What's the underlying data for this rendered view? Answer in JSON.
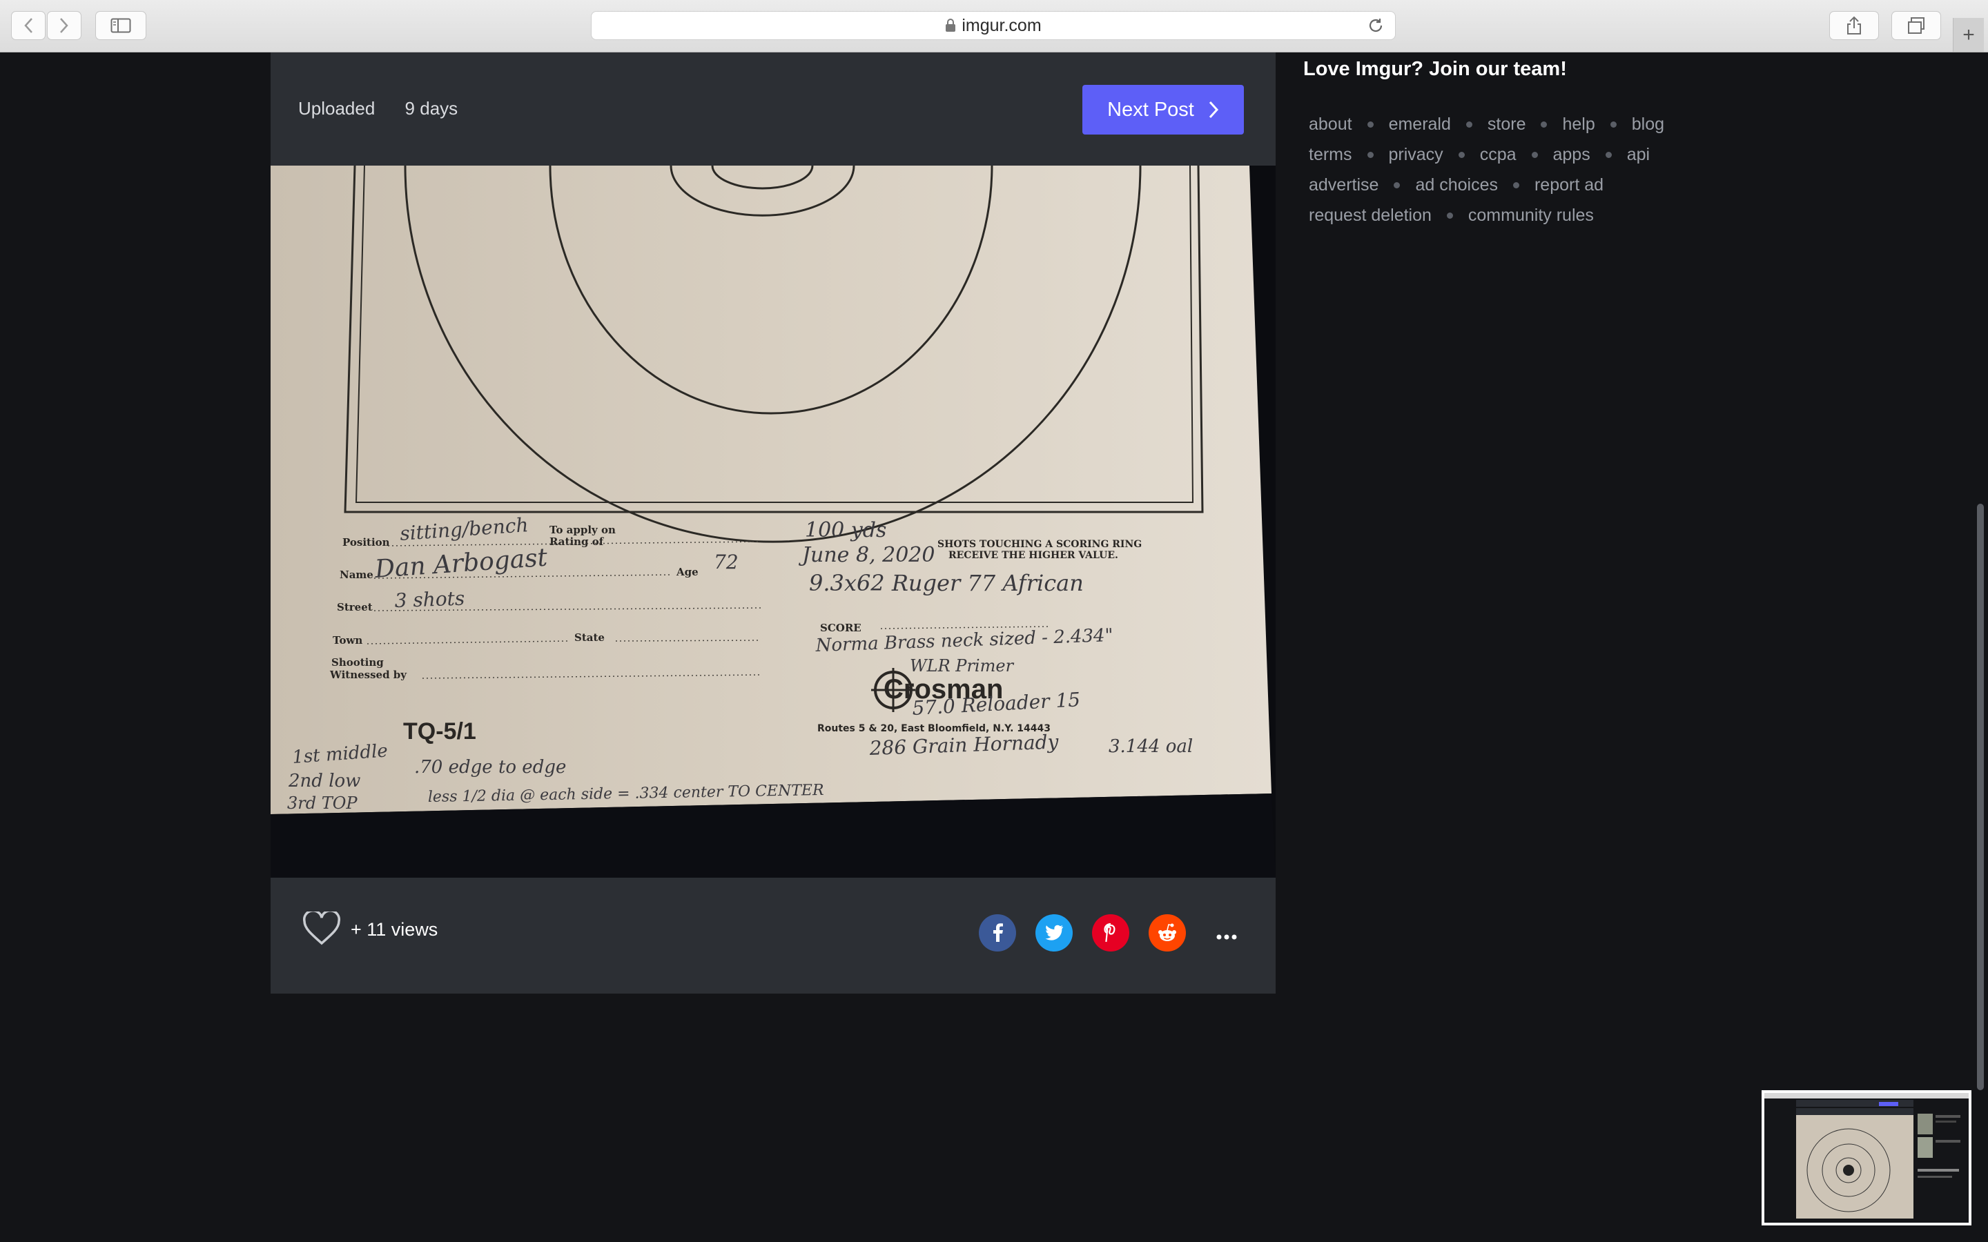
{
  "browser": {
    "url": "imgur.com",
    "new_tab": "+"
  },
  "post": {
    "uploaded_label": "Uploaded",
    "uploaded_age": "9 days",
    "next_post_label": "Next Post",
    "views": "+ 11 views"
  },
  "target": {
    "position_label": "Position",
    "position_value": "sitting/bench",
    "apply_label": "To apply on",
    "rating_label": "Rating of",
    "name_label": "Name",
    "name_value": "Dan Arbogast",
    "age_label": "Age",
    "age_value": "72",
    "street_label": "Street",
    "street_value": "3 shots",
    "town_label": "Town",
    "state_label": "State",
    "shooting_label": "Shooting",
    "witnessed_label": "Witnessed by",
    "distance": "100 yds",
    "date": "June 8, 2020",
    "shots_notice_1": "SHOTS TOUCHING A SCORING RING",
    "shots_notice_2": "RECEIVE THE HIGHER VALUE.",
    "rifle": "9.3x62 Ruger 77 African",
    "score_label": "SCORE",
    "brass": "Norma Brass neck sized - 2.434\"",
    "primer": "WLR Primer",
    "powder": "57.0 Reloader 15",
    "brand": "Crosman",
    "address": "Routes 5 & 20, East Bloomfield, N.Y. 14443",
    "bullet": "286 Grain Hornady",
    "oal": "3.144 oal",
    "form_code": "TQ-5/1",
    "note_1": "1st middle",
    "note_2": "2nd low",
    "note_3": "3rd TOP",
    "note_4": ".70 edge to edge",
    "note_5": "less 1/2 dia @ each side = .334 center TO CENTER"
  },
  "sidebar": {
    "title": "Love Imgur? Join our team!",
    "links": [
      [
        "about",
        "emerald",
        "store",
        "help",
        "blog"
      ],
      [
        "terms",
        "privacy",
        "ccpa",
        "apps",
        "api"
      ],
      [
        "advertise",
        "ad choices",
        "report ad"
      ],
      [
        "request deletion",
        "community rules"
      ]
    ]
  },
  "share": {
    "facebook_color": "#3b5998",
    "twitter_color": "#1da1f2",
    "pinterest_color": "#e60023",
    "reddit_color": "#ff4500"
  }
}
